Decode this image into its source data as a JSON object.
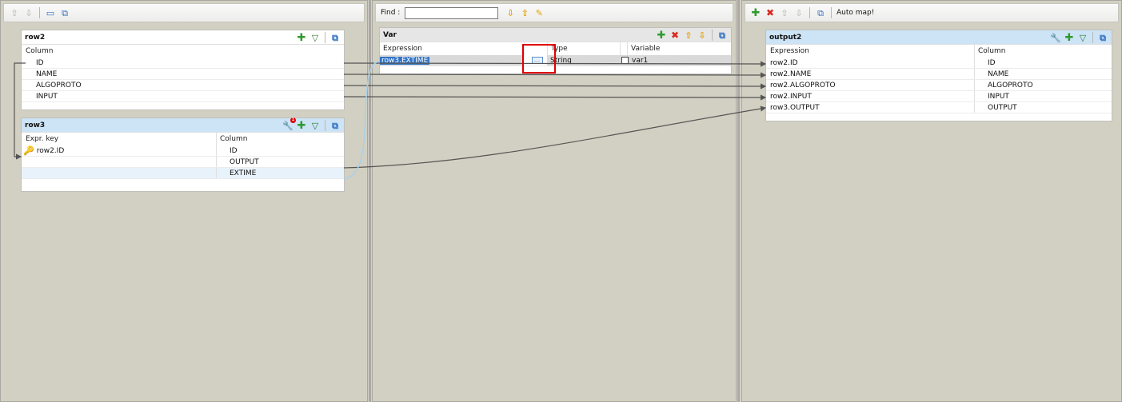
{
  "toolbars": {
    "left": {
      "icons": [
        "up-arrow-icon",
        "down-arrow-icon",
        "minimize-icon",
        "maximize-icon"
      ]
    },
    "mid": {
      "find_label": "Find :",
      "find_value": ""
    },
    "right": {
      "auto_map_label": "Auto map!"
    }
  },
  "row2": {
    "title": "row2",
    "column_header": "Column",
    "columns": [
      "ID",
      "NAME",
      "ALGOPROTO",
      "INPUT"
    ]
  },
  "row3": {
    "title": "row3",
    "expr_key_header": "Expr. key",
    "column_header": "Column",
    "rows": [
      {
        "expr": "row2.ID",
        "column": "ID"
      },
      {
        "expr": "",
        "column": "OUTPUT"
      },
      {
        "expr": "",
        "column": "EXTIME"
      }
    ]
  },
  "var": {
    "title": "Var",
    "headers": {
      "expression": "Expression",
      "type": "Type",
      "variable": "Variable"
    },
    "rows": [
      {
        "expression": "row3.EXTIME",
        "ellipsis": "...",
        "type": "String",
        "variable": "var1"
      }
    ]
  },
  "output2": {
    "title": "output2",
    "headers": {
      "expression": "Expression",
      "column": "Column"
    },
    "rows": [
      {
        "expression": "row2.ID",
        "column": "ID"
      },
      {
        "expression": "row2.NAME",
        "column": "NAME"
      },
      {
        "expression": "row2.ALGOPROTO",
        "column": "ALGOPROTO"
      },
      {
        "expression": "row2.INPUT",
        "column": "INPUT"
      },
      {
        "expression": "row3.OUTPUT",
        "column": "OUTPUT"
      }
    ]
  },
  "colors": {
    "selection": "#3374c4",
    "header_blue": "#cde3f6",
    "highlight_red": "#e00000",
    "link_line": "#555555",
    "link_blue": "#a8d0ea"
  }
}
